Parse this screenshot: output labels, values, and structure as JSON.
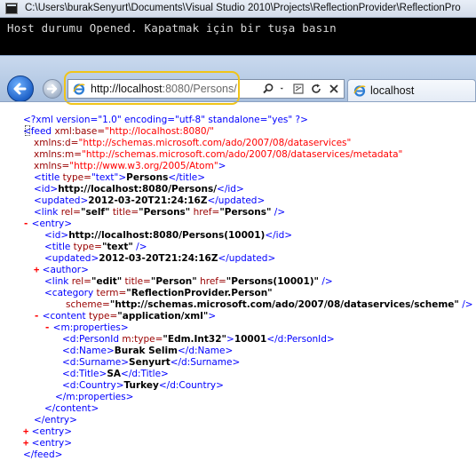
{
  "console": {
    "title": "C:\\Users\\burakSenyurt\\Documents\\Visual Studio 2010\\Projects\\ReflectionProvider\\ReflectionPro",
    "line": "Host durumu Opened. Kapatmak için bir tuşa basın"
  },
  "browser": {
    "url_host": "http://localhost",
    "url_rest": ":8080/Persons/",
    "tab_label": "localhost",
    "icons": [
      "back-icon",
      "forward-icon",
      "ie-logo-icon",
      "search-icon",
      "compat-view-icon",
      "refresh-icon",
      "stop-icon"
    ]
  },
  "xml": {
    "decl": "<?xml version=\"1.0\" encoding=\"utf-8\" standalone=\"yes\" ?>",
    "feed_open_tag": "<feed",
    "feed_base_attr": "xml:base=",
    "feed_base_val": "\"http://localhost:8080/\"",
    "ns1_attr": "xmlns:d=",
    "ns1_val": "\"http://schemas.microsoft.com/ado/2007/08/dataservices\"",
    "ns2_attr": "xmlns:m=",
    "ns2_val": "\"http://schemas.microsoft.com/ado/2007/08/dataservices/metadata\"",
    "ns3_attr": "xmlns=",
    "ns3_val": "\"http://www.w3.org/2005/Atom\"",
    "gt": ">",
    "title_open": "<title",
    "title_type_attr": "type=",
    "title_type_val": "\"text\"",
    "title_text": "Persons",
    "title_close": "</title>",
    "id_open": "<id>",
    "feed_id": "http://localhost:8080/Persons/",
    "id_close": "</id>",
    "updated_open": "<updated>",
    "feed_updated": "2012-03-20T21:24:16Z",
    "updated_close": "</updated>",
    "link_open": "<link",
    "link_rel_attr": "rel=",
    "link_rel_val": "\"self\"",
    "link_title_attr": "title=",
    "link_title_val": "\"Persons\"",
    "link_href_attr": "href=",
    "link_href_val": "\"Persons\"",
    "selfclose": "/>",
    "expand_minus": "-",
    "expand_plus": "+",
    "entry_open": "<entry>",
    "entry_id": "http://localhost:8080/Persons(10001)",
    "entry_title_text": "",
    "entry_updated": "2012-03-20T21:24:16Z",
    "author_tag": "<author>",
    "edit_rel_val": "\"edit\"",
    "edit_title_val": "\"Person\"",
    "edit_href_val": "\"Persons(10001)\"",
    "category_open": "<category",
    "category_term_attr": "term=",
    "category_term_val": "\"ReflectionProvider.Person\"",
    "category_scheme_attr": "scheme=",
    "category_scheme_val": "\"http://schemas.microsoft.com/ado/2007/08/dataservices/scheme\"",
    "content_open": "<content",
    "content_type_attr": "type=",
    "content_type_val": "\"application/xml\"",
    "mprops_open": "<m:properties>",
    "personid_open": "<d:PersonId",
    "personid_attr": "m:type=",
    "personid_type": "\"Edm.Int32\"",
    "personid_value": "10001",
    "personid_close": "</d:PersonId>",
    "name_open": "<d:Name>",
    "name_value": "Burak Selim",
    "name_close": "</d:Name>",
    "surname_open": "<d:Surname>",
    "surname_value": "Senyurt",
    "surname_close": "</d:Surname>",
    "dtitle_open": "<d:Title>",
    "dtitle_value": "SA",
    "dtitle_close": "</d:Title>",
    "country_open": "<d:Country>",
    "country_value": "Turkey",
    "country_close": "</d:Country>",
    "mprops_close": "</m:properties>",
    "content_close": "</content>",
    "entry_close": "</entry>",
    "feed_close": "</feed>"
  }
}
